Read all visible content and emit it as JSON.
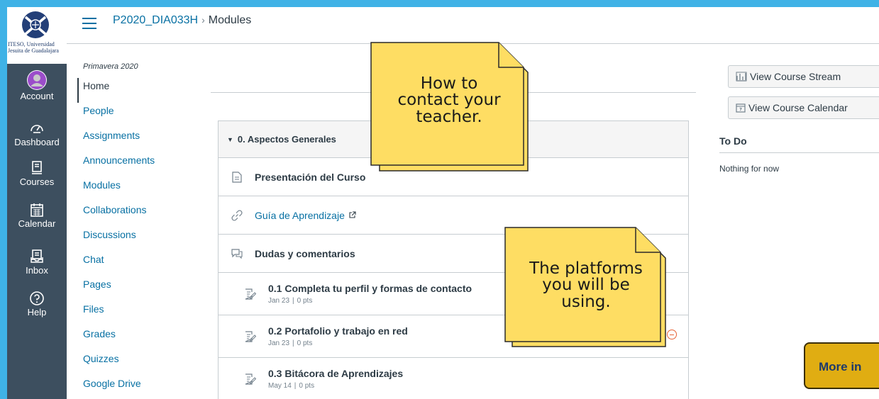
{
  "brand": {
    "logo_line1": "ITESO, Universidad",
    "logo_line2": "Jesuita de Guadalajara",
    "accent": "#3fb2e6"
  },
  "global_nav": [
    {
      "label": "Account",
      "icon": "avatar-icon"
    },
    {
      "label": "Dashboard",
      "icon": "dashboard-icon"
    },
    {
      "label": "Courses",
      "icon": "courses-icon"
    },
    {
      "label": "Calendar",
      "icon": "calendar-icon"
    },
    {
      "label": "Inbox",
      "icon": "inbox-icon"
    },
    {
      "label": "Help",
      "icon": "help-icon"
    }
  ],
  "header": {
    "course": "P2020_DIA033H",
    "separator": "›",
    "page": "Modules"
  },
  "course_nav": {
    "term": "Primavera 2020",
    "items": [
      "Home",
      "People",
      "Assignments",
      "Announcements",
      "Modules",
      "Collaborations",
      "Discussions",
      "Chat",
      "Pages",
      "Files",
      "Grades",
      "Quizzes",
      "Google Drive"
    ]
  },
  "module": {
    "title": "0. Aspectos Generales",
    "items": [
      {
        "title": "Presentación del Curso",
        "icon": "page-icon"
      },
      {
        "title": "Guía de Aprendizaje",
        "icon": "link-icon",
        "external_icon": "external-link-icon"
      },
      {
        "title": "Dudas y comentarios",
        "icon": "discussion-icon"
      },
      {
        "title": "0.1 Completa tu perfil y formas de contacto",
        "date": "Jan 23",
        "points": "0 pts",
        "icon": "assignment-icon"
      },
      {
        "title": "0.2 Portafolio y trabajo en red",
        "date": "Jan 23",
        "points": "0 pts",
        "icon": "assignment-icon"
      },
      {
        "title": "0.3 Bitácora de Aprendizajes",
        "date": "May 14",
        "points": "0 pts",
        "icon": "assignment-icon"
      }
    ]
  },
  "sidebar_right": {
    "stream_button": "View Course Stream",
    "calendar_button": "View Course Calendar",
    "todo_title": "To Do",
    "todo_empty": "Nothing for now"
  },
  "notes": {
    "note1": [
      "How to",
      "contact your",
      "teacher."
    ],
    "note2": [
      "The platforms",
      "you will be",
      "using."
    ],
    "note_color": "#fedd63"
  },
  "more_button": "More in"
}
